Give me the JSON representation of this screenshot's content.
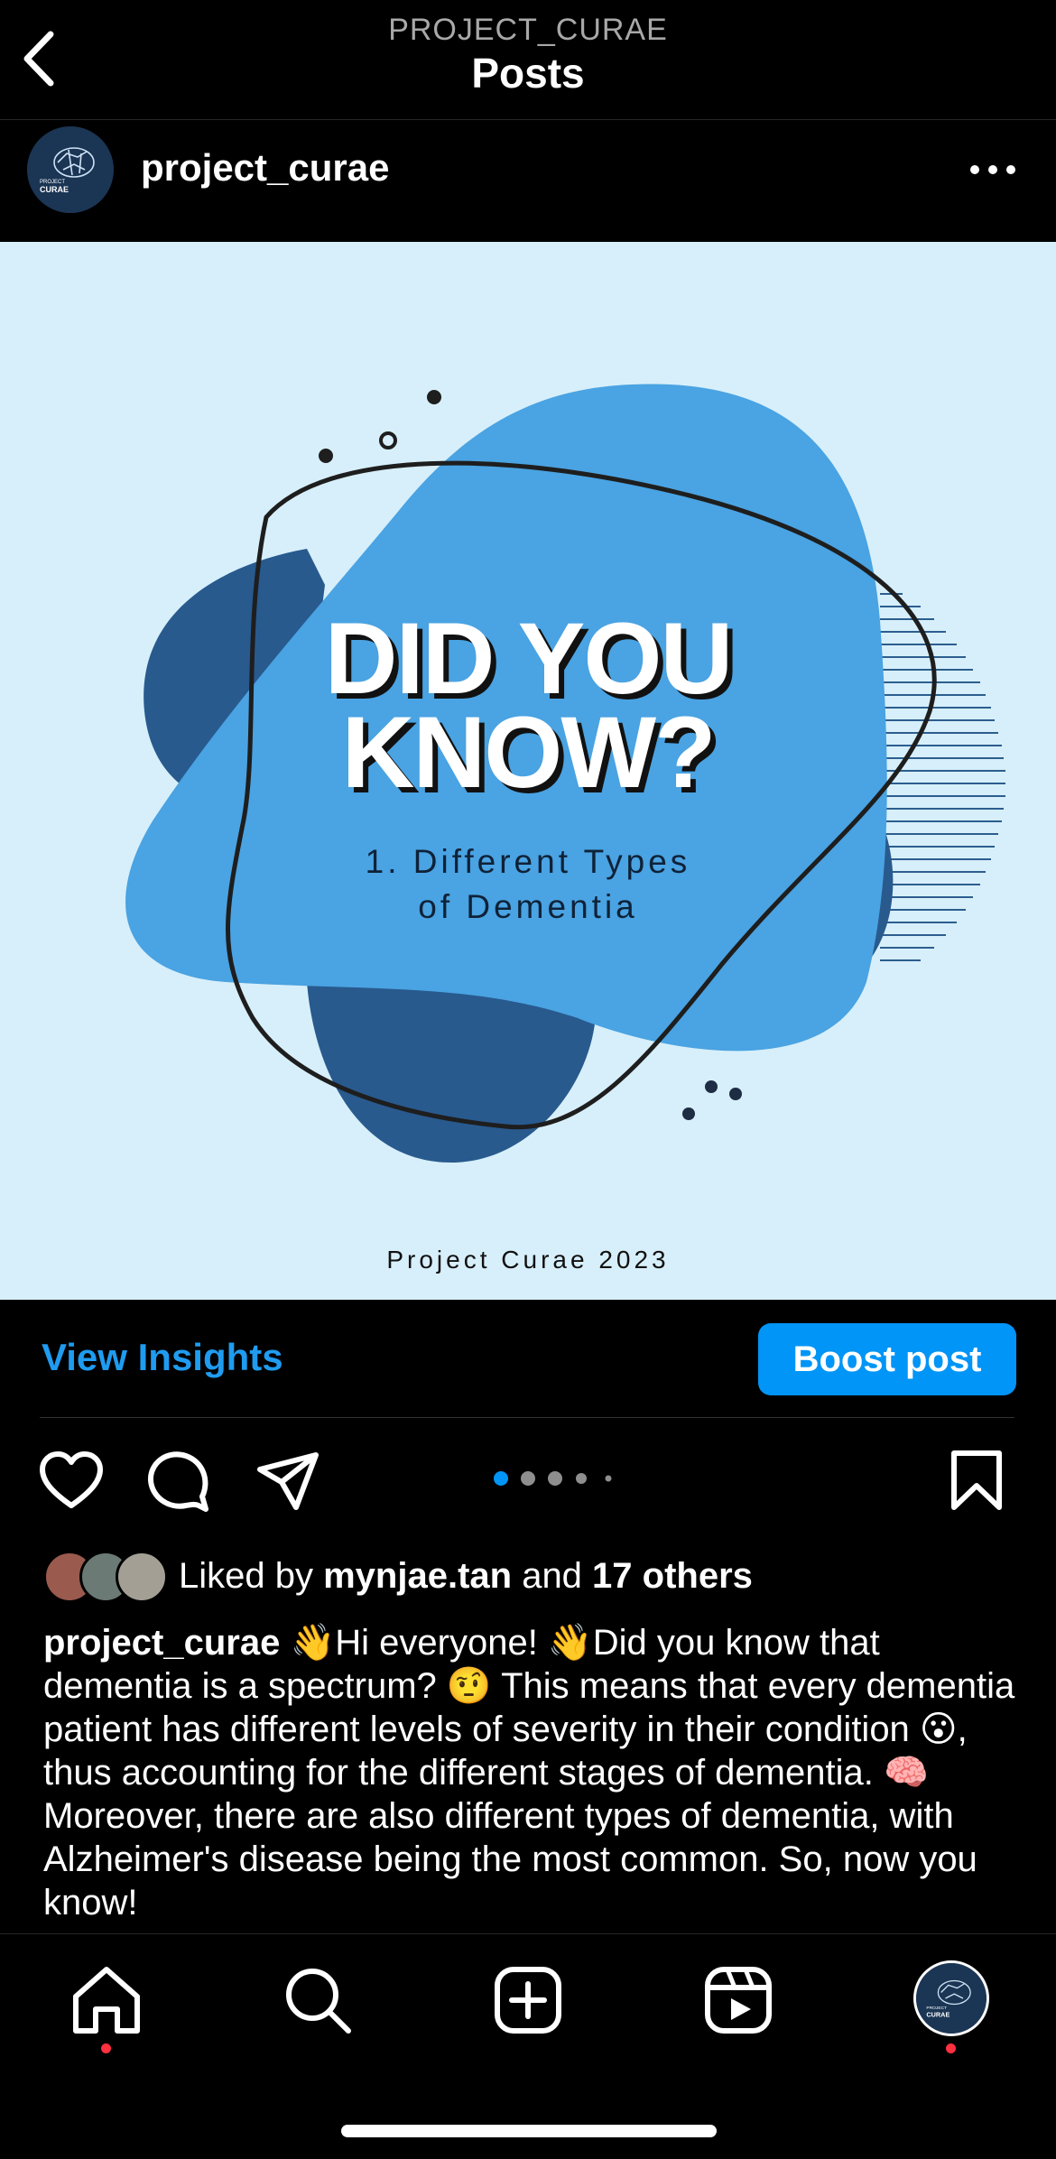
{
  "header": {
    "account": "PROJECT_CURAE",
    "title": "Posts"
  },
  "post": {
    "username": "project_curae",
    "image": {
      "headline_line1": "DID YOU",
      "headline_line2": "KNOW?",
      "subtitle_line1": "1. Different Types",
      "subtitle_line2": "of Dementia",
      "footer": "Project Curae 2023",
      "background_color": "#d7effa",
      "blob_light": "#4aa3e2",
      "blob_dark": "#285a8e"
    },
    "view_insights_label": "View Insights",
    "boost_label": "Boost post",
    "carousel": {
      "total": 5,
      "active": 1
    },
    "likes": {
      "prefix": "Liked by ",
      "user": "mynjae.tan",
      "middle": " and ",
      "others": "17 others"
    },
    "caption": {
      "username": "project_curae",
      "text": " 👋Hi everyone! 👋Did you know that dementia is a spectrum? 🤨 This means that every dementia patient has different levels of severity in their condition 😮, thus accounting for the different stages of dementia. 🧠 Moreover, there are also different types of dementia, with Alzheimer's disease being the most common. So, now you know!"
    }
  },
  "avatar_text": {
    "line1": "PROJECT",
    "line2": "CURAE"
  },
  "colors": {
    "accent": "#0095f6",
    "link": "#1f9cf0",
    "notification": "#ff3040"
  }
}
